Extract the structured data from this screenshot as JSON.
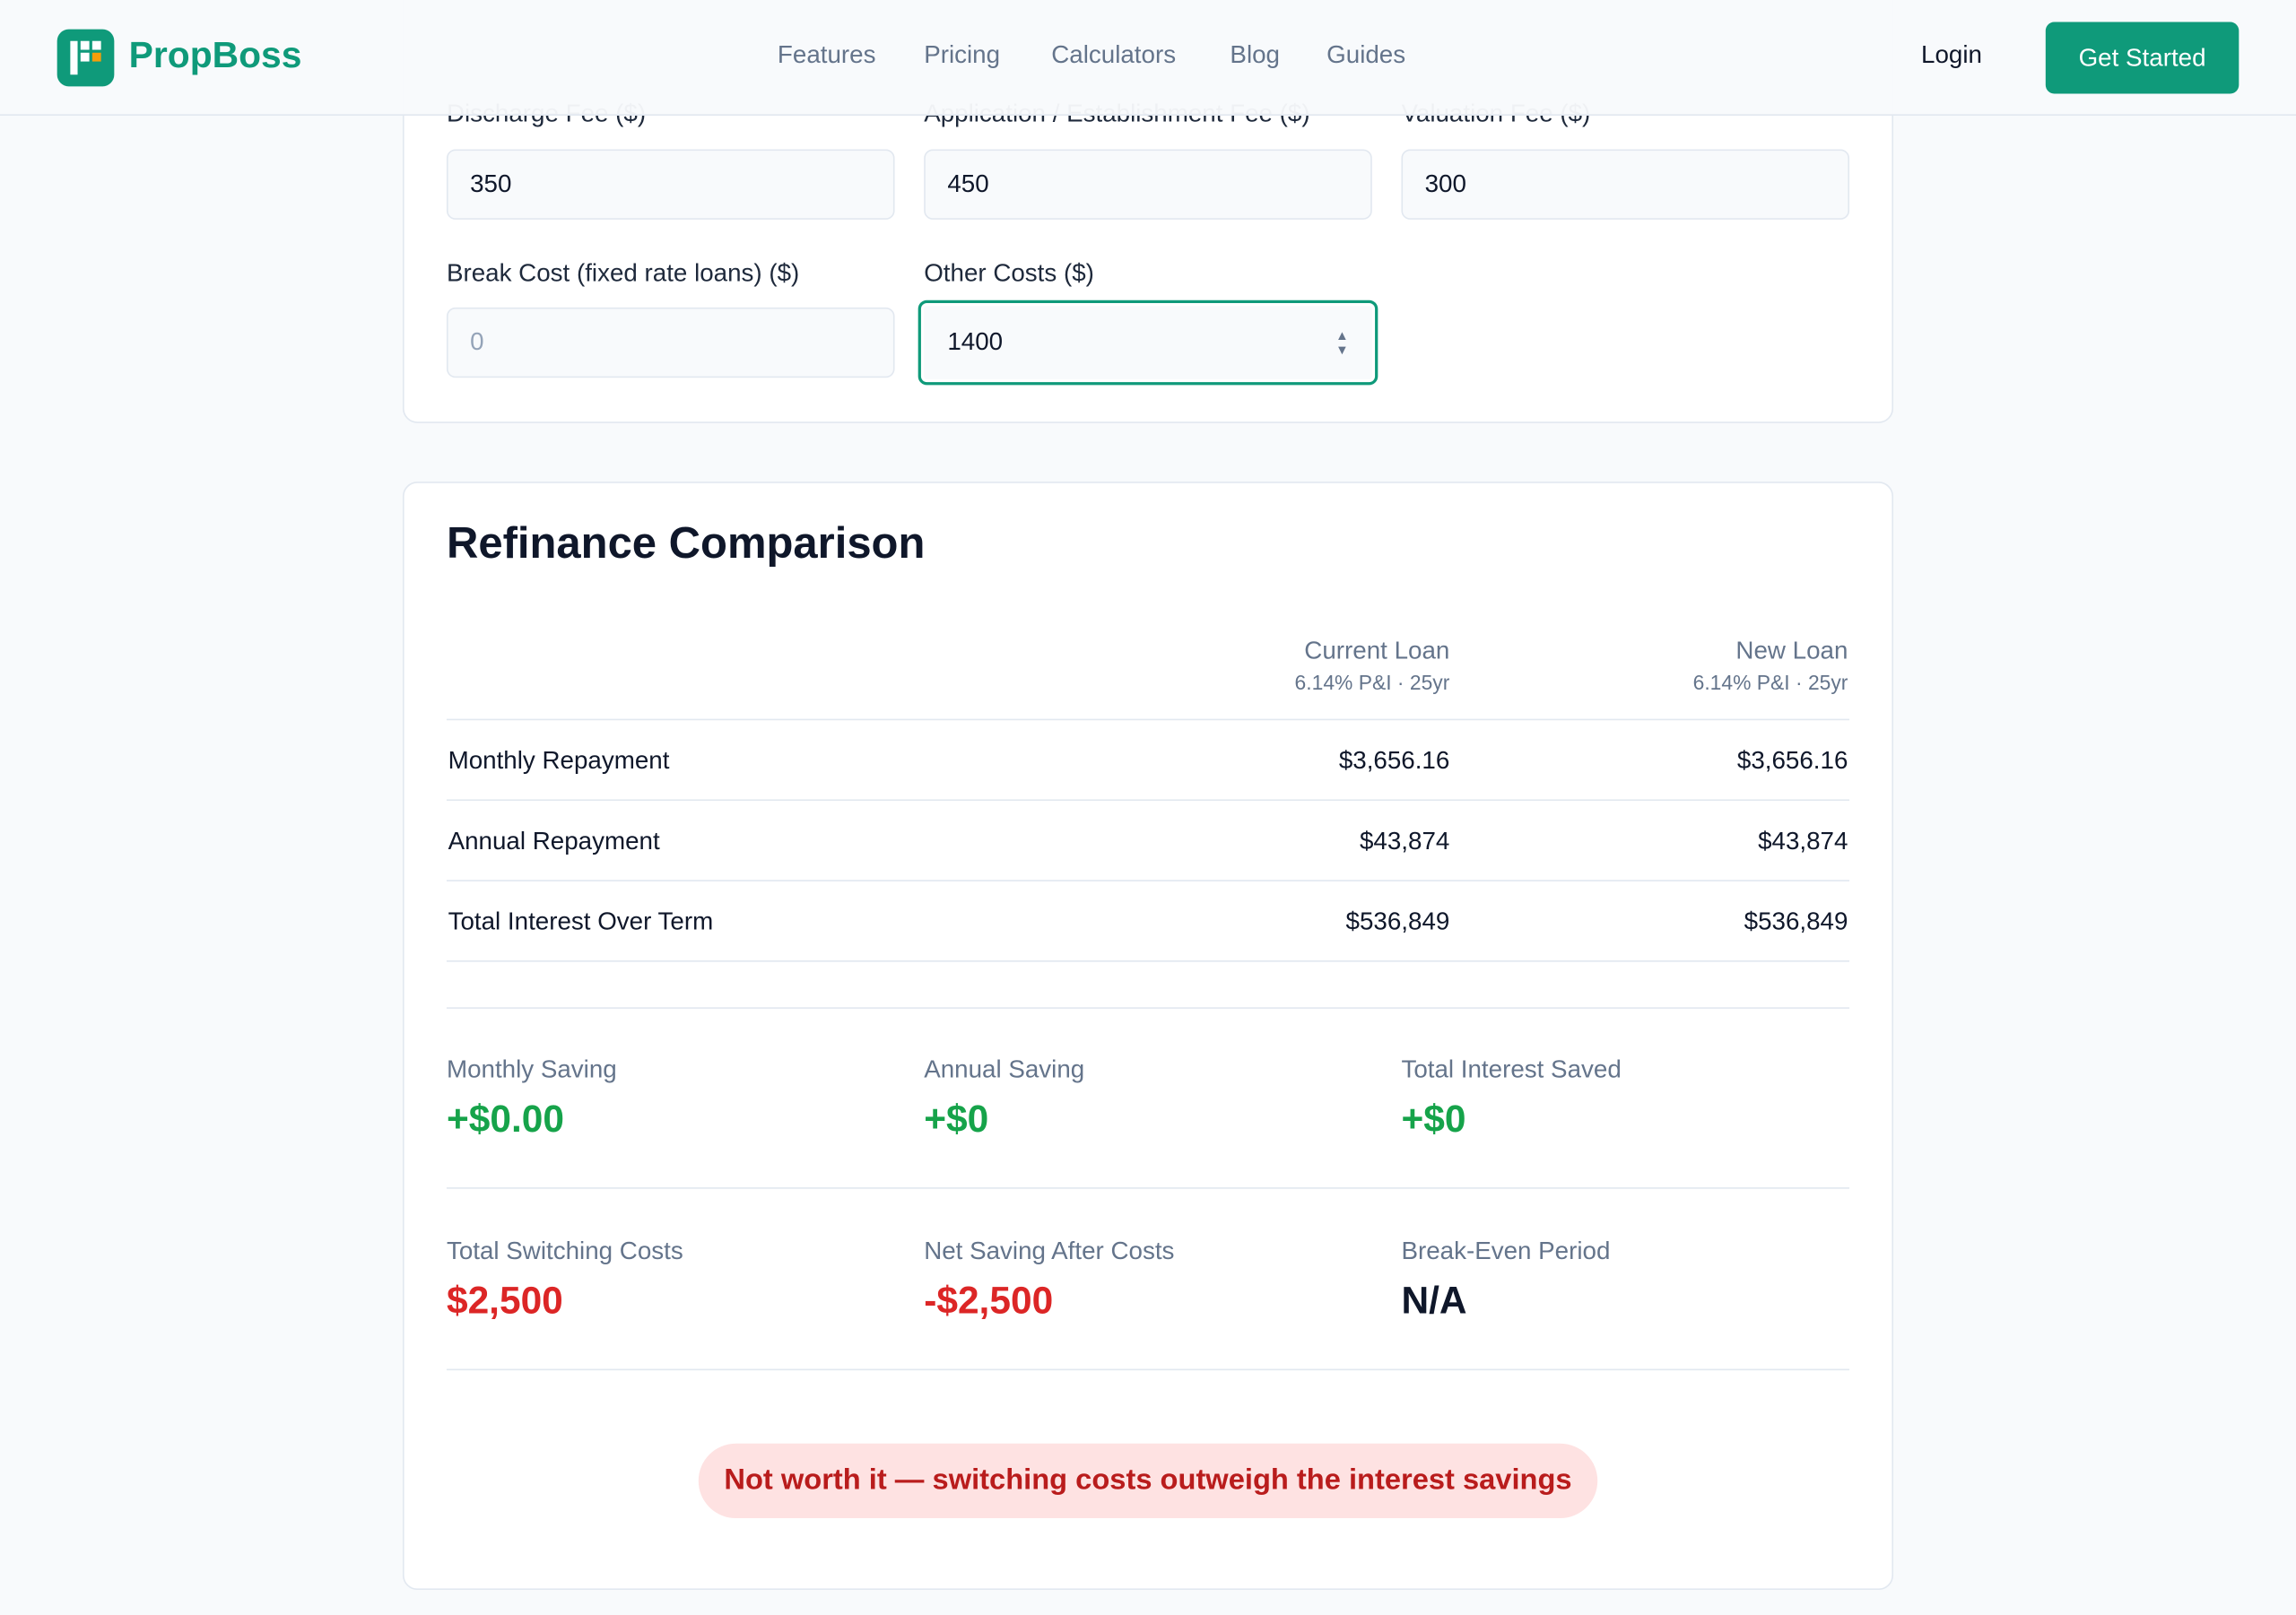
{
  "header": {
    "brand": "PropBoss",
    "nav": [
      "Features",
      "Pricing",
      "Calculators",
      "Blog",
      "Guides"
    ],
    "login": "Login",
    "cta": "Get Started"
  },
  "costs": {
    "fields": [
      {
        "label": "Discharge Fee ($)",
        "value": "350"
      },
      {
        "label": "Application / Establishment Fee ($)",
        "value": "450"
      },
      {
        "label": "Valuation Fee ($)",
        "value": "300"
      },
      {
        "label": "Break Cost (fixed rate loans) ($)",
        "value": "",
        "placeholder": "0"
      },
      {
        "label": "Other Costs ($)",
        "value": "1400"
      }
    ]
  },
  "comparison": {
    "title": "Refinance Comparison",
    "columns": [
      {
        "name": "Current Loan",
        "sub": "6.14% P&I · 25yr"
      },
      {
        "name": "New Loan",
        "sub": "6.14% P&I · 25yr"
      }
    ],
    "rows": [
      {
        "label": "Monthly Repayment",
        "current": "$3,656.16",
        "new": "$3,656.16"
      },
      {
        "label": "Annual Repayment",
        "current": "$43,874",
        "new": "$43,874"
      },
      {
        "label": "Total Interest Over Term",
        "current": "$536,849",
        "new": "$536,849"
      }
    ],
    "savings": [
      {
        "label": "Monthly Saving",
        "value": "+$0.00"
      },
      {
        "label": "Annual Saving",
        "value": "+$0"
      },
      {
        "label": "Total Interest Saved",
        "value": "+$0"
      }
    ],
    "costs": [
      {
        "label": "Total Switching Costs",
        "value": "$2,500"
      },
      {
        "label": "Net Saving After Costs",
        "value": "-$2,500"
      },
      {
        "label": "Break-Even Period",
        "value": "N/A"
      }
    ],
    "verdict": "Not worth it — switching costs outweigh the interest savings"
  },
  "colors": {
    "brand": "#0f9a7a",
    "positive": "#16a34a",
    "negative": "#dc2626"
  }
}
